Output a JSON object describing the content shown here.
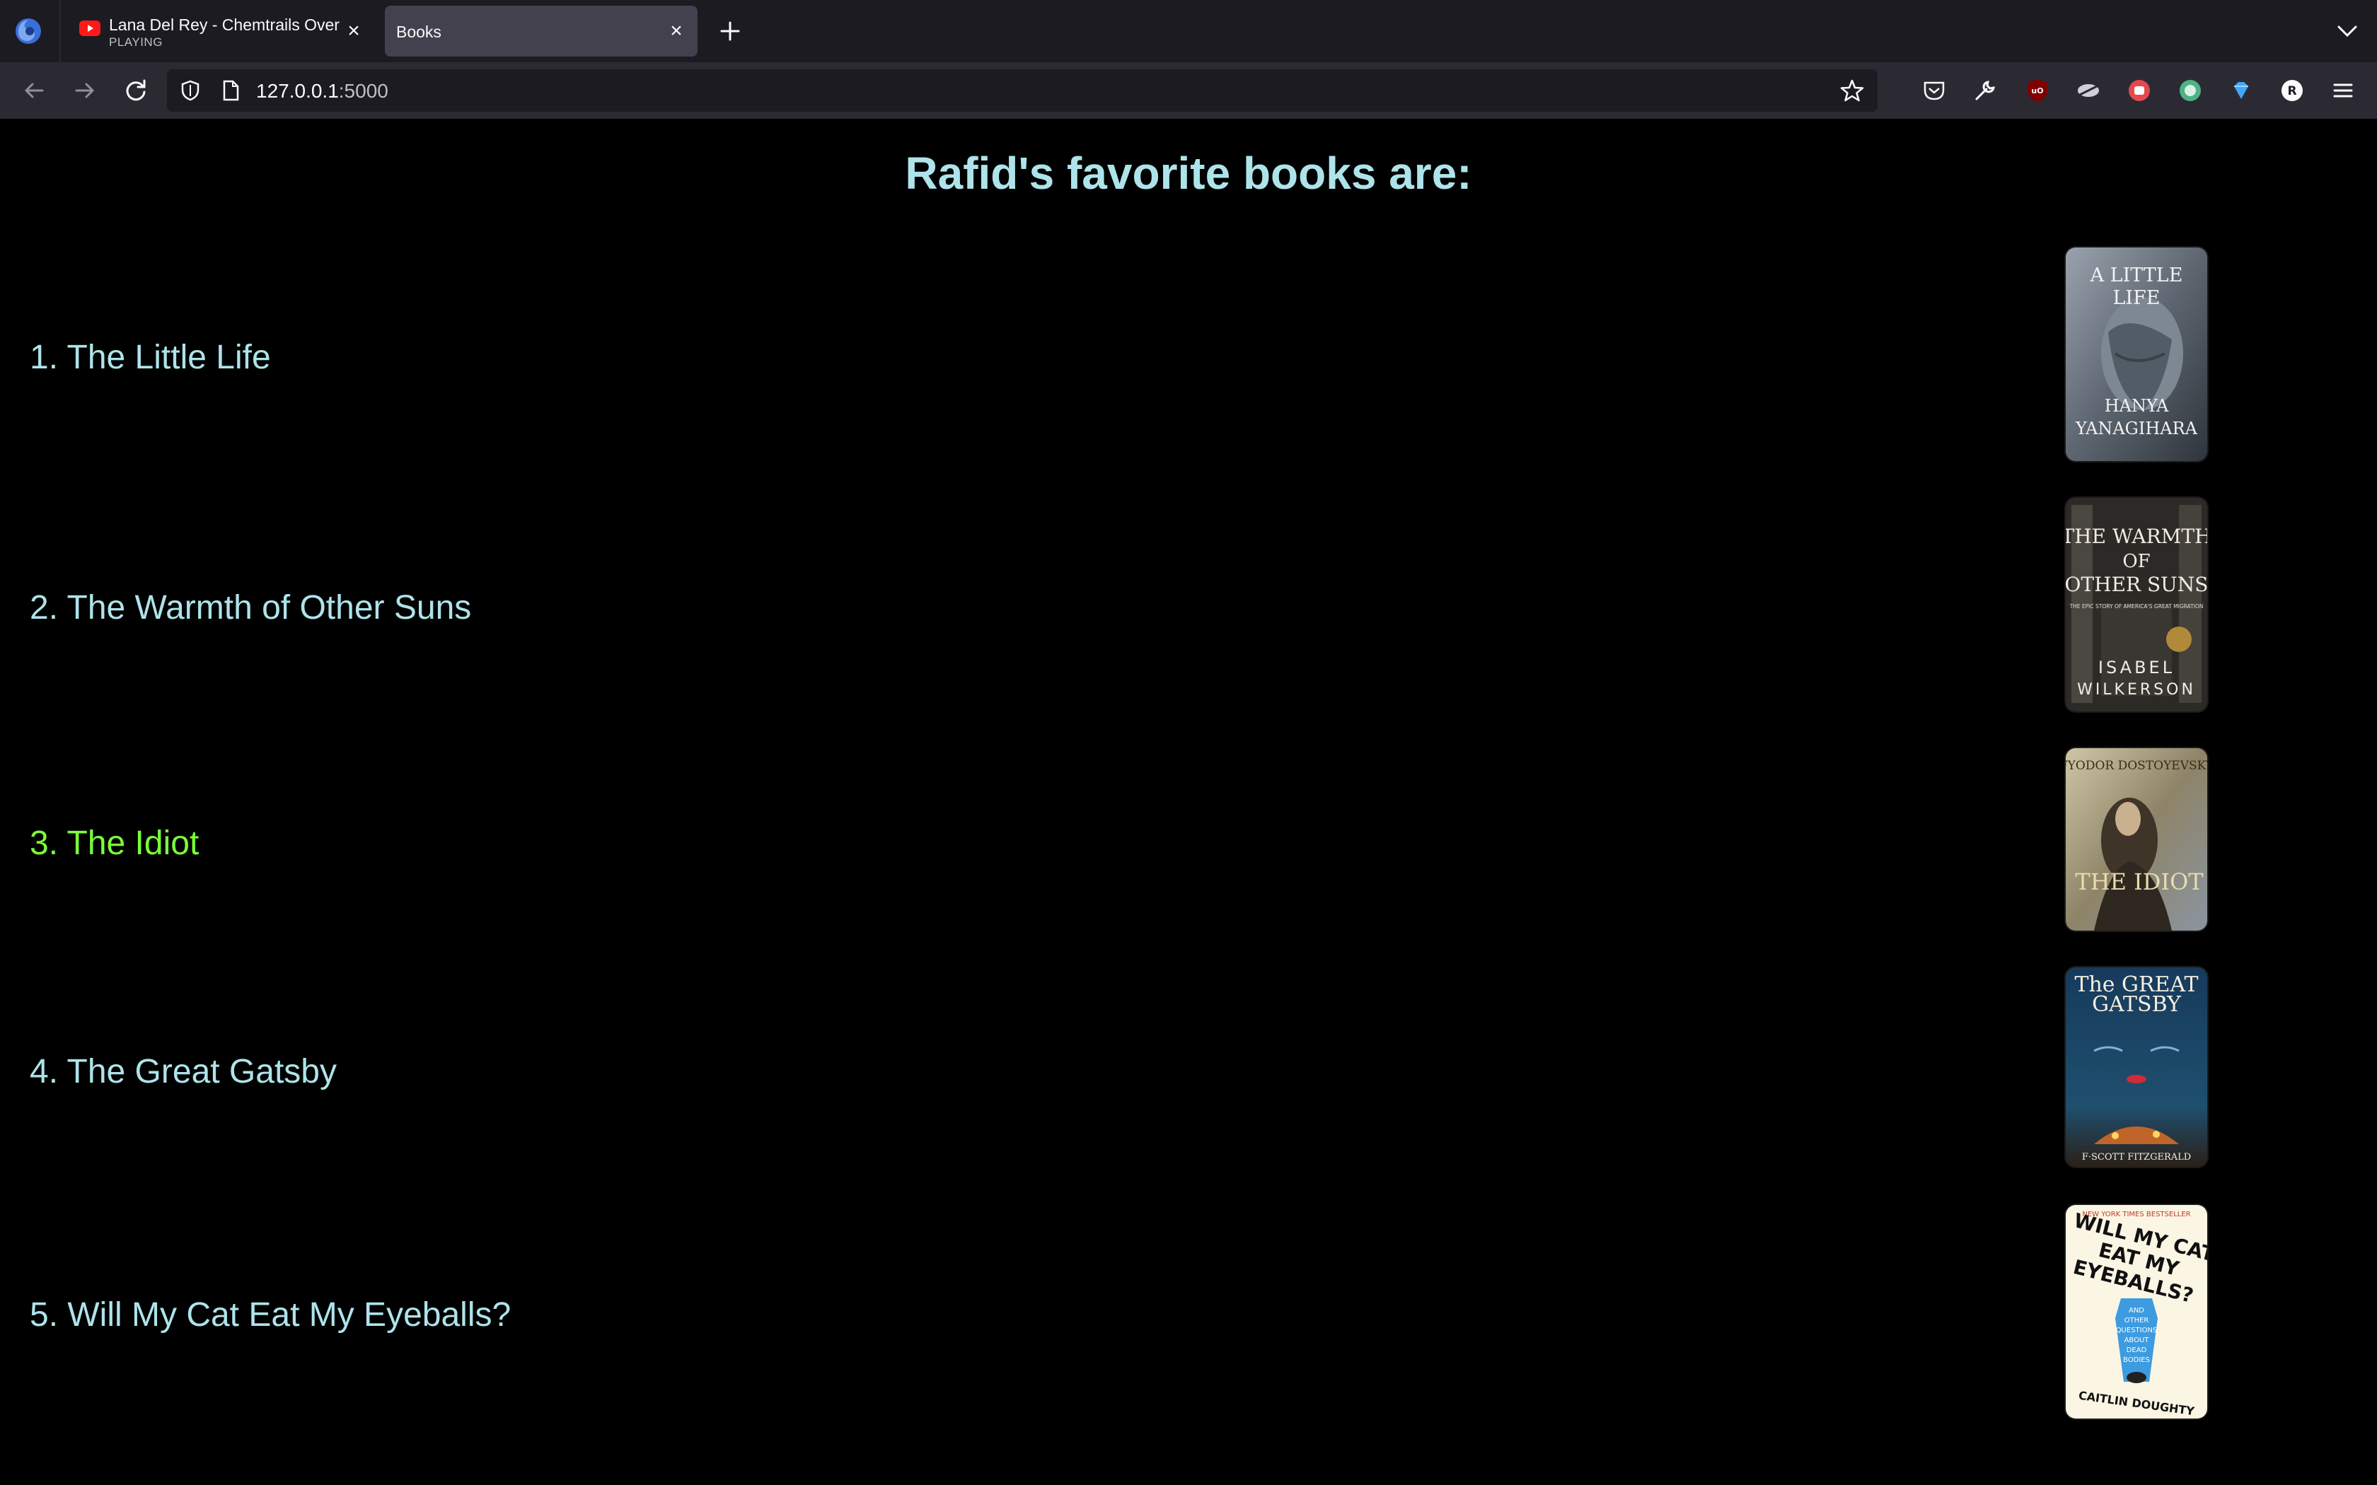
{
  "browser": {
    "tabs": [
      {
        "title": "Lana Del Rey - Chemtrails Over",
        "subtitle": "PLAYING",
        "icon": "youtube-icon",
        "active": false
      },
      {
        "title": "Books",
        "active": true
      }
    ],
    "url_host": "127.0.0.1",
    "url_port": ":5000"
  },
  "page": {
    "heading": "Rafid's favorite books are:",
    "books": [
      {
        "label": "1. The Little Life",
        "highlighted": false
      },
      {
        "label": "2. The Warmth of Other Suns",
        "highlighted": false
      },
      {
        "label": "3. The Idiot",
        "highlighted": true
      },
      {
        "label": "4. The Great Gatsby",
        "highlighted": false
      },
      {
        "label": "5. Will My Cat Eat My Eyeballs?",
        "highlighted": false
      }
    ],
    "covers": {
      "little_life": {
        "line1": "A LITTLE",
        "line2": "LIFE",
        "author1": "HANYA",
        "author2": "YANAGIHARA"
      },
      "warmth": {
        "line1": "THE WARMTH",
        "line2": "OF",
        "line3": "OTHER SUNS",
        "tag": "THE EPIC STORY OF AMERICA'S GREAT MIGRATION",
        "author1": "ISABEL",
        "author2": "WILKERSON"
      },
      "idiot": {
        "author": "FYODOR DOSTOYEVSKY",
        "title": "THE IDIOT"
      },
      "gatsby": {
        "line1": "The GREAT",
        "line2": "GATSBY",
        "author": "F·SCOTT FITZGERALD"
      },
      "cat": {
        "banner": "NEW YORK TIMES BESTSELLER",
        "line1": "WILL MY CAT",
        "line2": "EAT MY",
        "line3": "EYEBALLS?",
        "sub1": "AND",
        "sub2": "OTHER",
        "sub3": "QUESTIONS",
        "sub4": "ABOUT",
        "sub5": "DEAD",
        "sub6": "BODIES",
        "author": "CAITLIN DOUGHTY"
      }
    }
  },
  "colors": {
    "text": "#aee3ea",
    "highlight": "#7bff3a",
    "background": "#000000"
  }
}
